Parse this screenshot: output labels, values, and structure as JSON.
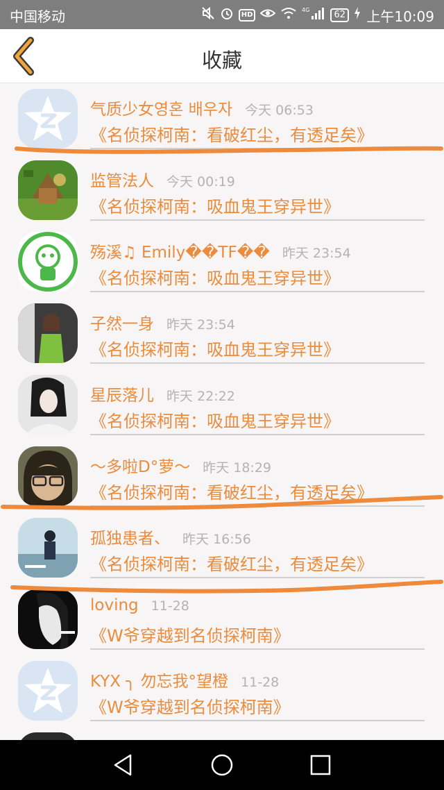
{
  "status_bar": {
    "carrier": "中国移动",
    "icons": [
      "mute-icon",
      "alarm-icon",
      "hd-icon",
      "eye-icon",
      "wifi-icon",
      "signal-icon",
      "battery-icon",
      "charging-icon"
    ],
    "hd_label": "HD",
    "network_label": "4G",
    "battery": "62",
    "clock": "上午10:09"
  },
  "header": {
    "title": "收藏",
    "back_icon": "chevron-left-icon",
    "accent_color": "#f3a43a"
  },
  "list": {
    "items": [
      {
        "name": "气质少女영혼 배우자",
        "time": "今天 06:53",
        "subtitle": "《名侦探柯南：看破红尘，有透足矣》",
        "avatar": "default-star"
      },
      {
        "name": "监管法人",
        "time": "今天 00:19",
        "subtitle": "《名侦探柯南：吸血鬼王穿异世》",
        "avatar": "game-art"
      },
      {
        "name": "殇溪♫ Emily��TF��",
        "time": "昨天 23:54",
        "subtitle": "《名侦探柯南：吸血鬼王穿异世》",
        "avatar": "green-logo"
      },
      {
        "name": "子然一身",
        "time": "昨天 23:54",
        "subtitle": "《名侦探柯南：吸血鬼王穿异世》",
        "avatar": "girl-green"
      },
      {
        "name": "星辰落儿",
        "time": "昨天 22:22",
        "subtitle": "《名侦探柯南：吸血鬼王穿异世》",
        "avatar": "girl-bw"
      },
      {
        "name": "～多啦D°萝～",
        "time": "昨天 18:29",
        "subtitle": "《名侦探柯南：看破红尘，有透足矣》",
        "avatar": "girl-glasses"
      },
      {
        "name": "孤独患者、",
        "time": "昨天 16:56",
        "subtitle": "《名侦探柯南：看破红尘，有透足矣》",
        "avatar": "person-scene"
      },
      {
        "name": "loving",
        "time": "11-28",
        "subtitle": "《W爷穿越到名侦探柯南》",
        "avatar": "bw-face"
      },
      {
        "name": "KYX ╮ 勿忘我°望橙",
        "time": "11-28",
        "subtitle": "《W爷穿越到名侦探柯南》",
        "avatar": "default-star"
      },
      {
        "name": "",
        "time": "",
        "subtitle": "",
        "avatar": "partial-dark"
      }
    ]
  },
  "colors": {
    "name_text": "#ea8c3c",
    "time_text": "#b3b3b3",
    "annotation_stroke": "#ee8a3c",
    "background": "#f7f5f5"
  },
  "nav_bar": {
    "icons": [
      "back-triangle-icon",
      "home-circle-icon",
      "recents-square-icon"
    ]
  }
}
